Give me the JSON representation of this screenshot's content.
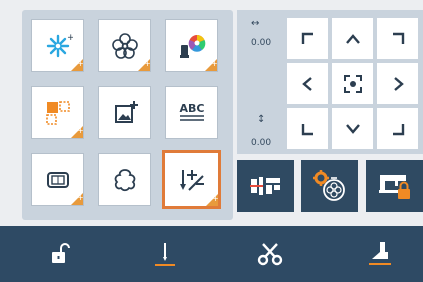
{
  "stitch_tiles": [
    {
      "name": "decorative-stitch-icon",
      "selected": false
    },
    {
      "name": "embroidery-flower-icon",
      "selected": false
    },
    {
      "name": "color-palette-icon",
      "selected": false
    },
    {
      "name": "pattern-combine-icon",
      "selected": false
    },
    {
      "name": "image-add-icon",
      "selected": false
    },
    {
      "name": "text-abc-icon",
      "selected": false,
      "label": "ABC"
    },
    {
      "name": "hoop-frame-icon",
      "selected": false
    },
    {
      "name": "outline-shape-icon",
      "selected": false
    },
    {
      "name": "stitch-edit-icon",
      "selected": true
    }
  ],
  "position": {
    "horizontal_value": "0.00",
    "vertical_value": "0.00"
  },
  "move_buttons": [
    "up-left",
    "up",
    "up-right",
    "left",
    "center",
    "right",
    "down-left",
    "down",
    "down-right"
  ],
  "function_buttons": [
    "thread-cutter",
    "embroidery-settings",
    "machine-locked"
  ],
  "bottom_bar": [
    "unlock",
    "needle-position",
    "scissors",
    "presser-foot"
  ],
  "colors": {
    "accent": "#e07b39",
    "panel": "#c9d3dd",
    "dark": "#2e4a64",
    "icon": "#2c3e50"
  }
}
